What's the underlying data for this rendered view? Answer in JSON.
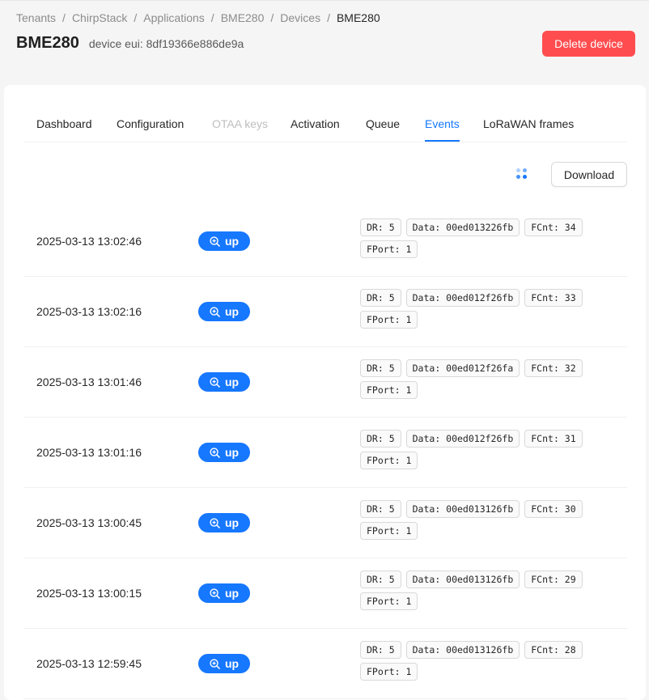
{
  "breadcrumb": [
    "Tenants",
    "ChirpStack",
    "Applications",
    "BME280",
    "Devices",
    "BME280"
  ],
  "breadcrumb_separator": "/",
  "header": {
    "title": "BME280",
    "subtitle": "device eui: 8df19366e886de9a",
    "delete_label": "Delete device"
  },
  "tabs": [
    {
      "label": "Dashboard",
      "state": "normal"
    },
    {
      "label": "Configuration",
      "state": "normal"
    },
    {
      "label": "OTAA keys",
      "state": "disabled"
    },
    {
      "label": "Activation",
      "state": "normal"
    },
    {
      "label": "Queue",
      "state": "normal"
    },
    {
      "label": "Events",
      "state": "active"
    },
    {
      "label": "LoRaWAN frames",
      "state": "normal"
    }
  ],
  "toolbar": {
    "download_label": "Download",
    "loading_icon": "loading-dots-icon"
  },
  "colors": {
    "primary": "#1677ff",
    "danger": "#ff4d4f"
  },
  "events": [
    {
      "time": "2025-03-13 13:02:46",
      "type": "up",
      "tags": [
        "DR: 5",
        "Data: 00ed013226fb",
        "FCnt: 34",
        "FPort: 1"
      ]
    },
    {
      "time": "2025-03-13 13:02:16",
      "type": "up",
      "tags": [
        "DR: 5",
        "Data: 00ed012f26fb",
        "FCnt: 33",
        "FPort: 1"
      ]
    },
    {
      "time": "2025-03-13 13:01:46",
      "type": "up",
      "tags": [
        "DR: 5",
        "Data: 00ed012f26fa",
        "FCnt: 32",
        "FPort: 1"
      ]
    },
    {
      "time": "2025-03-13 13:01:16",
      "type": "up",
      "tags": [
        "DR: 5",
        "Data: 00ed012f26fb",
        "FCnt: 31",
        "FPort: 1"
      ]
    },
    {
      "time": "2025-03-13 13:00:45",
      "type": "up",
      "tags": [
        "DR: 5",
        "Data: 00ed013126fb",
        "FCnt: 30",
        "FPort: 1"
      ]
    },
    {
      "time": "2025-03-13 13:00:15",
      "type": "up",
      "tags": [
        "DR: 5",
        "Data: 00ed013126fb",
        "FCnt: 29",
        "FPort: 1"
      ]
    },
    {
      "time": "2025-03-13 12:59:45",
      "type": "up",
      "tags": [
        "DR: 5",
        "Data: 00ed013126fb",
        "FCnt: 28",
        "FPort: 1"
      ]
    }
  ]
}
